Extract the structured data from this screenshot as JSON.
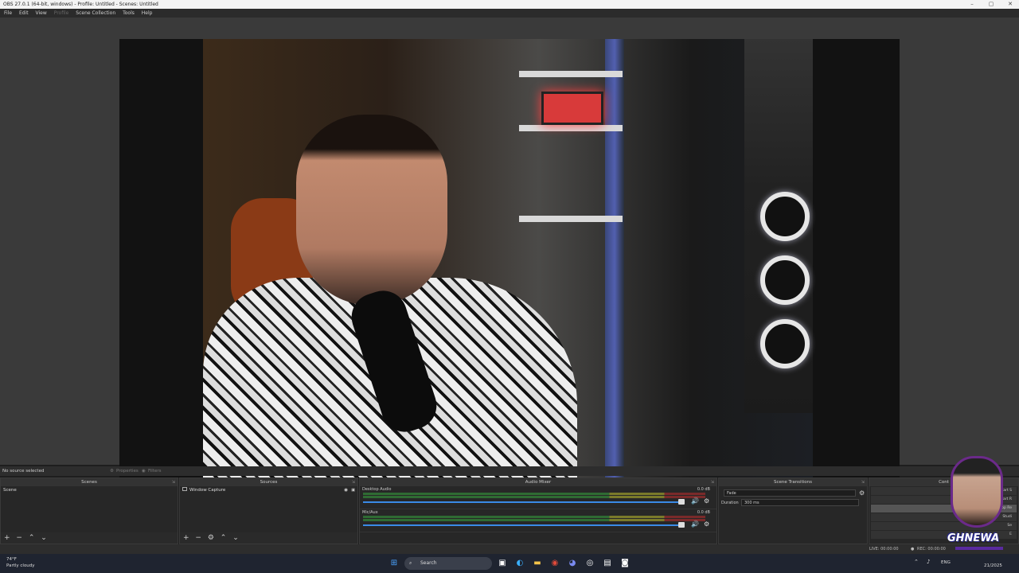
{
  "window": {
    "title": "OBS 27.0.1 (64-bit, windows) - Profile: Untitled - Scenes: Untitled",
    "minimize": "–",
    "maximize": "▢",
    "close": "✕"
  },
  "menu": {
    "file": "File",
    "edit": "Edit",
    "view": "View",
    "profile": "Profile",
    "scene_collection": "Scene Collection",
    "tools": "Tools",
    "help": "Help"
  },
  "source_bar": {
    "no_selection": "No source selected",
    "properties": "Properties",
    "filters": "Filters"
  },
  "scenes": {
    "title": "Scenes",
    "items": [
      "Scene"
    ]
  },
  "sources": {
    "title": "Sources",
    "items": [
      "Window Capture"
    ]
  },
  "audio_mixer": {
    "title": "Audio Mixer",
    "channels": [
      {
        "name": "Desktop Audio",
        "db": "0.0 dB",
        "level": 0.93
      },
      {
        "name": "Mic/Aux",
        "db": "0.0 dB",
        "level": 0.93
      }
    ]
  },
  "transitions": {
    "title": "Scene Transitions",
    "type": "Fade",
    "duration_label": "Duration",
    "duration": "300 ms"
  },
  "controls": {
    "title": "Cont",
    "buttons": [
      "Start S",
      "Start R",
      "Stop Re",
      "Studi",
      "Se",
      "E"
    ]
  },
  "status": {
    "live": "LIVE: 00:00:00",
    "rec": "REC: 00:00:00"
  },
  "taskbar": {
    "weather_temp": "74°F",
    "weather_desc": "Partly cloudy",
    "search": "Search",
    "lang": "ENG",
    "date": "21/2025"
  },
  "overlay": {
    "badge": "GHNEWA"
  },
  "icons": {
    "add": "+",
    "remove": "−",
    "up": "⌃",
    "down": "⌄",
    "gear": "⚙",
    "eye": "◉",
    "lock": "🔒",
    "speaker": "🔊"
  }
}
